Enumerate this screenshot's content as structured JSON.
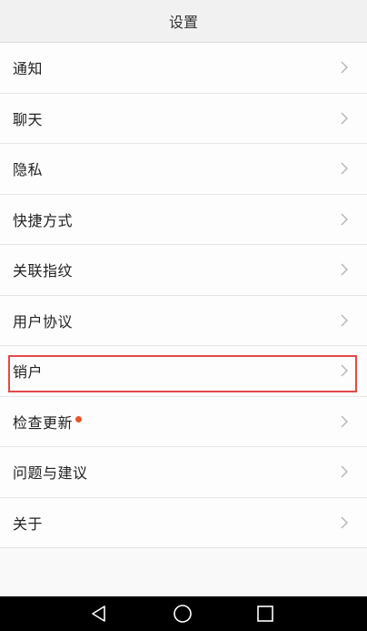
{
  "header": {
    "title": "设置"
  },
  "settings": {
    "items": [
      {
        "label": "通知"
      },
      {
        "label": "聊天"
      },
      {
        "label": "隐私"
      },
      {
        "label": "快捷方式"
      },
      {
        "label": "关联指纹"
      },
      {
        "label": "用户协议"
      },
      {
        "label": "销户"
      },
      {
        "label": "检查更新"
      },
      {
        "label": "问题与建议"
      },
      {
        "label": "关于"
      }
    ]
  },
  "colors": {
    "update_dot": "#e8542a",
    "highlight_border": "#e24a4a",
    "navbar": "#000000"
  },
  "icons": {
    "row_arrow": "chevron-right-icon",
    "nav_back": "triangle-back-icon",
    "nav_home": "circle-home-icon",
    "nav_recent": "square-recent-icon"
  }
}
